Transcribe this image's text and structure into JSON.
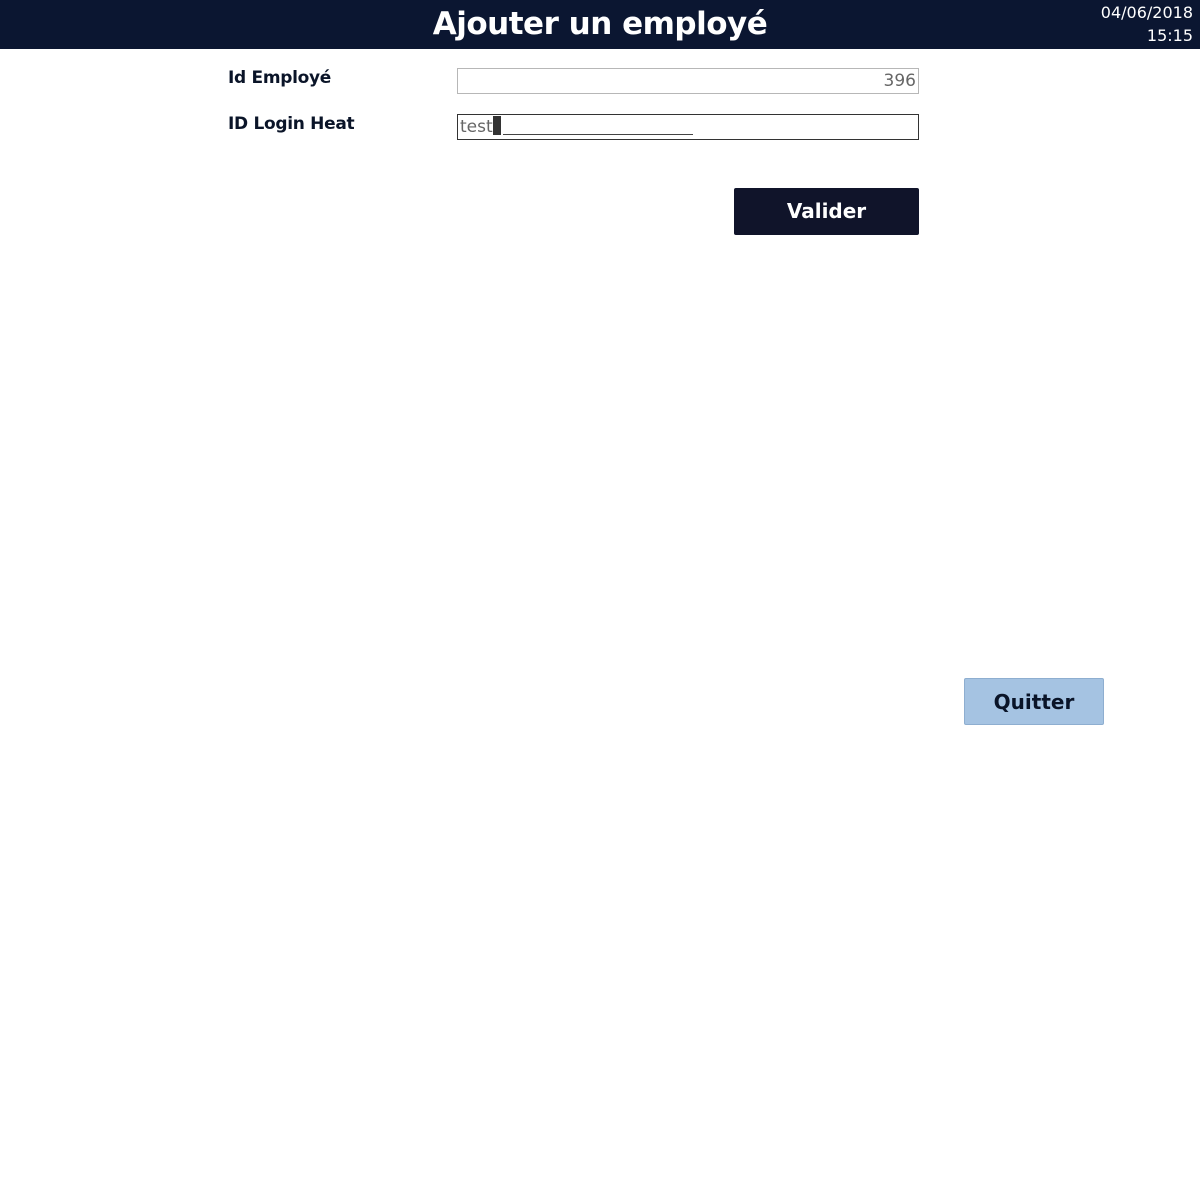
{
  "header": {
    "title": "Ajouter un employé",
    "date": "04/06/2018",
    "time": "15:15",
    "background_color": "#0b1631"
  },
  "form": {
    "employee_id": {
      "label": "Id Employé",
      "value": "396"
    },
    "login_heat": {
      "label": "ID Login Heat",
      "value": "test"
    }
  },
  "actions": {
    "validate_label": "Valider",
    "quit_label": "Quitter"
  }
}
